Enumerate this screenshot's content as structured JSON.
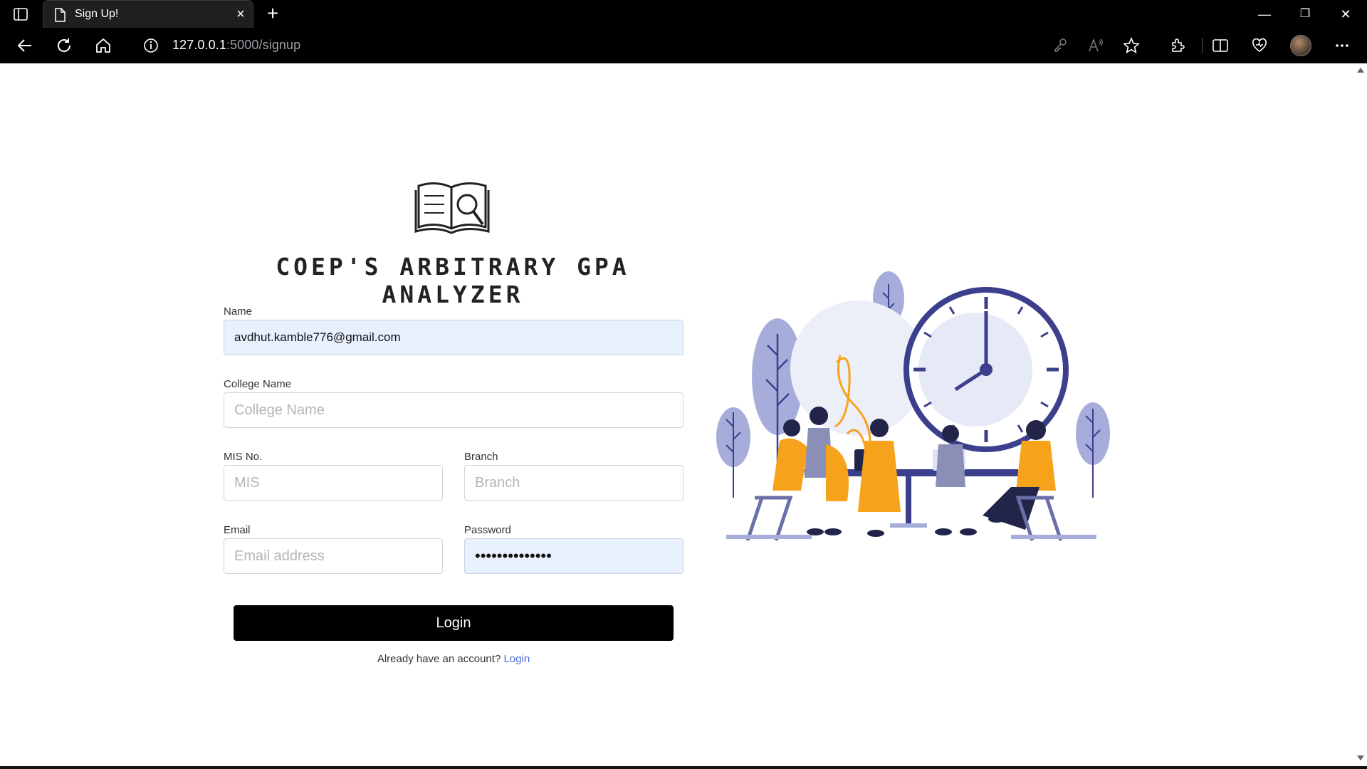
{
  "browser": {
    "tab_title": "Sign Up!",
    "close_glyph": "×",
    "new_tab_glyph": "+",
    "minimize_glyph": "—",
    "restore_glyph": "❐",
    "close_window_glyph": "✕",
    "url_host": "127.0.0.1",
    "url_path": ":5000/signup"
  },
  "app": {
    "title": "COEP'S ARBITRARY GPA ANALYZER"
  },
  "form": {
    "name_label": "Name",
    "name_value": "avdhut.kamble776@gmail.com",
    "college_label": "College Name",
    "college_placeholder": "College Name",
    "mis_label": "MIS No.",
    "mis_placeholder": "MIS",
    "branch_label": "Branch",
    "branch_placeholder": "Branch",
    "email_label": "Email",
    "email_placeholder": "Email address",
    "password_label": "Password",
    "password_value": "••••••••••••••",
    "submit_label": "Login",
    "already_text": "Already have an account?",
    "login_link": "Login"
  },
  "colors": {
    "accent_link": "#4a6ad8",
    "autofill_bg": "#e8f0fe",
    "illustration_navy": "#3c3f8c",
    "illustration_orange": "#f7a21b",
    "illustration_lavender": "#a7addb"
  }
}
